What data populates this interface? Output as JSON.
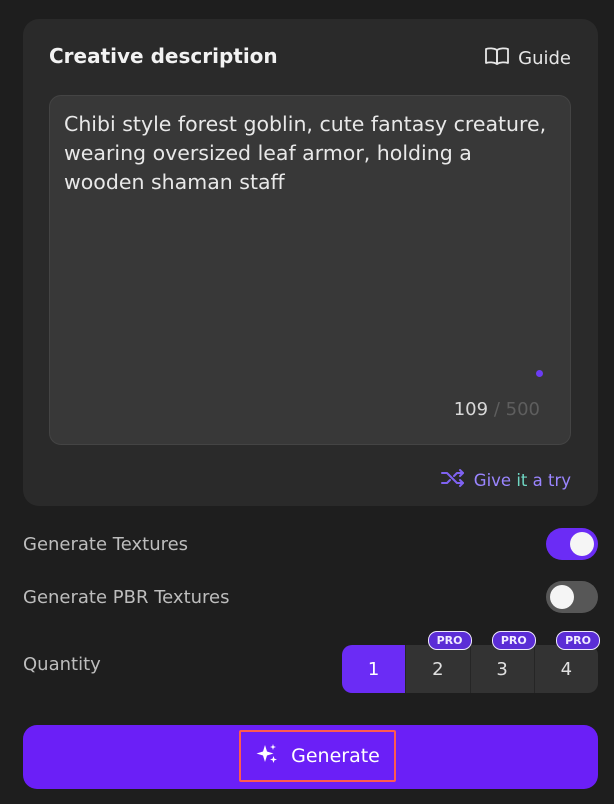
{
  "panel": {
    "title": "Creative description",
    "guide_label": "Guide",
    "guide_icon": "book-open-icon"
  },
  "prompt": {
    "text": "Chibi style forest goblin, cute fantasy creature, wearing oversized leaf armor, holding a wooden shaman staff",
    "char_count": "109",
    "separator": "/",
    "char_max": "500"
  },
  "try_link": {
    "prefix": "Give ",
    "highlight": "it",
    "suffix": " a try",
    "icon": "shuffle-icon"
  },
  "options": {
    "textures_label": "Generate Textures",
    "textures_on": true,
    "pbr_label": "Generate PBR Textures",
    "pbr_on": false
  },
  "quantity": {
    "label": "Quantity",
    "options": [
      "1",
      "2",
      "3",
      "4"
    ],
    "selected": "1",
    "pro_badge": "PRO"
  },
  "generate": {
    "label": "Generate",
    "icon": "sparkle-icon"
  },
  "colors": {
    "accent": "#6b2cf5",
    "highlight_box": "#ff5a4f",
    "background": "#1e1e1e",
    "card": "#2a2a2a"
  }
}
